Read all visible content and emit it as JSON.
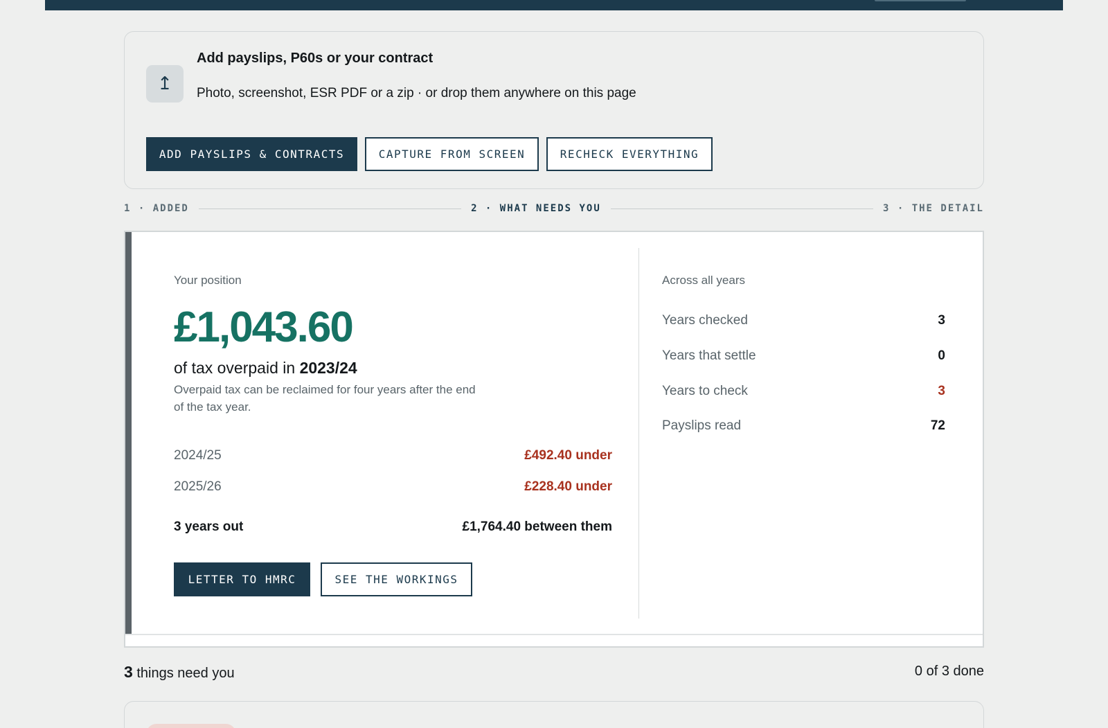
{
  "upload": {
    "icon": "upload-arrow-icon",
    "title": "Add payslips, P60s or your contract",
    "subtitle": "Photo, screenshot, ESR PDF or a zip · or drop them anywhere on this page",
    "buttons": {
      "add": "ADD PAYSLIPS & CONTRACTS",
      "capture": "CAPTURE FROM SCREEN",
      "recheck": "RECHECK EVERYTHING"
    }
  },
  "steps": [
    {
      "label": "1 · ADDED",
      "active": false
    },
    {
      "label": "2 · WHAT NEEDS YOU",
      "active": true
    },
    {
      "label": "3 · THE DETAIL",
      "active": false
    }
  ],
  "position": {
    "label": "Your position",
    "amount": "£1,043.60",
    "line_prefix": "of tax overpaid in ",
    "line_year": "2023/24",
    "note": "Overpaid tax can be reclaimed for four years after the end of the tax year.",
    "years": [
      {
        "year": "2024/25",
        "value": "£492.40 under"
      },
      {
        "year": "2025/26",
        "value": "£228.40 under"
      }
    ],
    "total_label": "3 years out",
    "total_value": "£1,764.40 between them",
    "buttons": {
      "letter": "LETTER TO HMRC",
      "workings": "SEE THE WORKINGS"
    }
  },
  "summary": {
    "title": "Across all years",
    "rows": [
      {
        "label": "Years checked",
        "value": "3"
      },
      {
        "label": "Years that settle",
        "value": "0"
      },
      {
        "label": "Years to check",
        "value": "3",
        "warn": true
      },
      {
        "label": "Payslips read",
        "value": "72"
      }
    ]
  },
  "tasks": {
    "count": "3",
    "count_suffix": " things need you",
    "progress": "0 of 3 done"
  },
  "colors": {
    "navy": "#1c3a4c",
    "green": "#167263",
    "red": "#a8321f"
  }
}
